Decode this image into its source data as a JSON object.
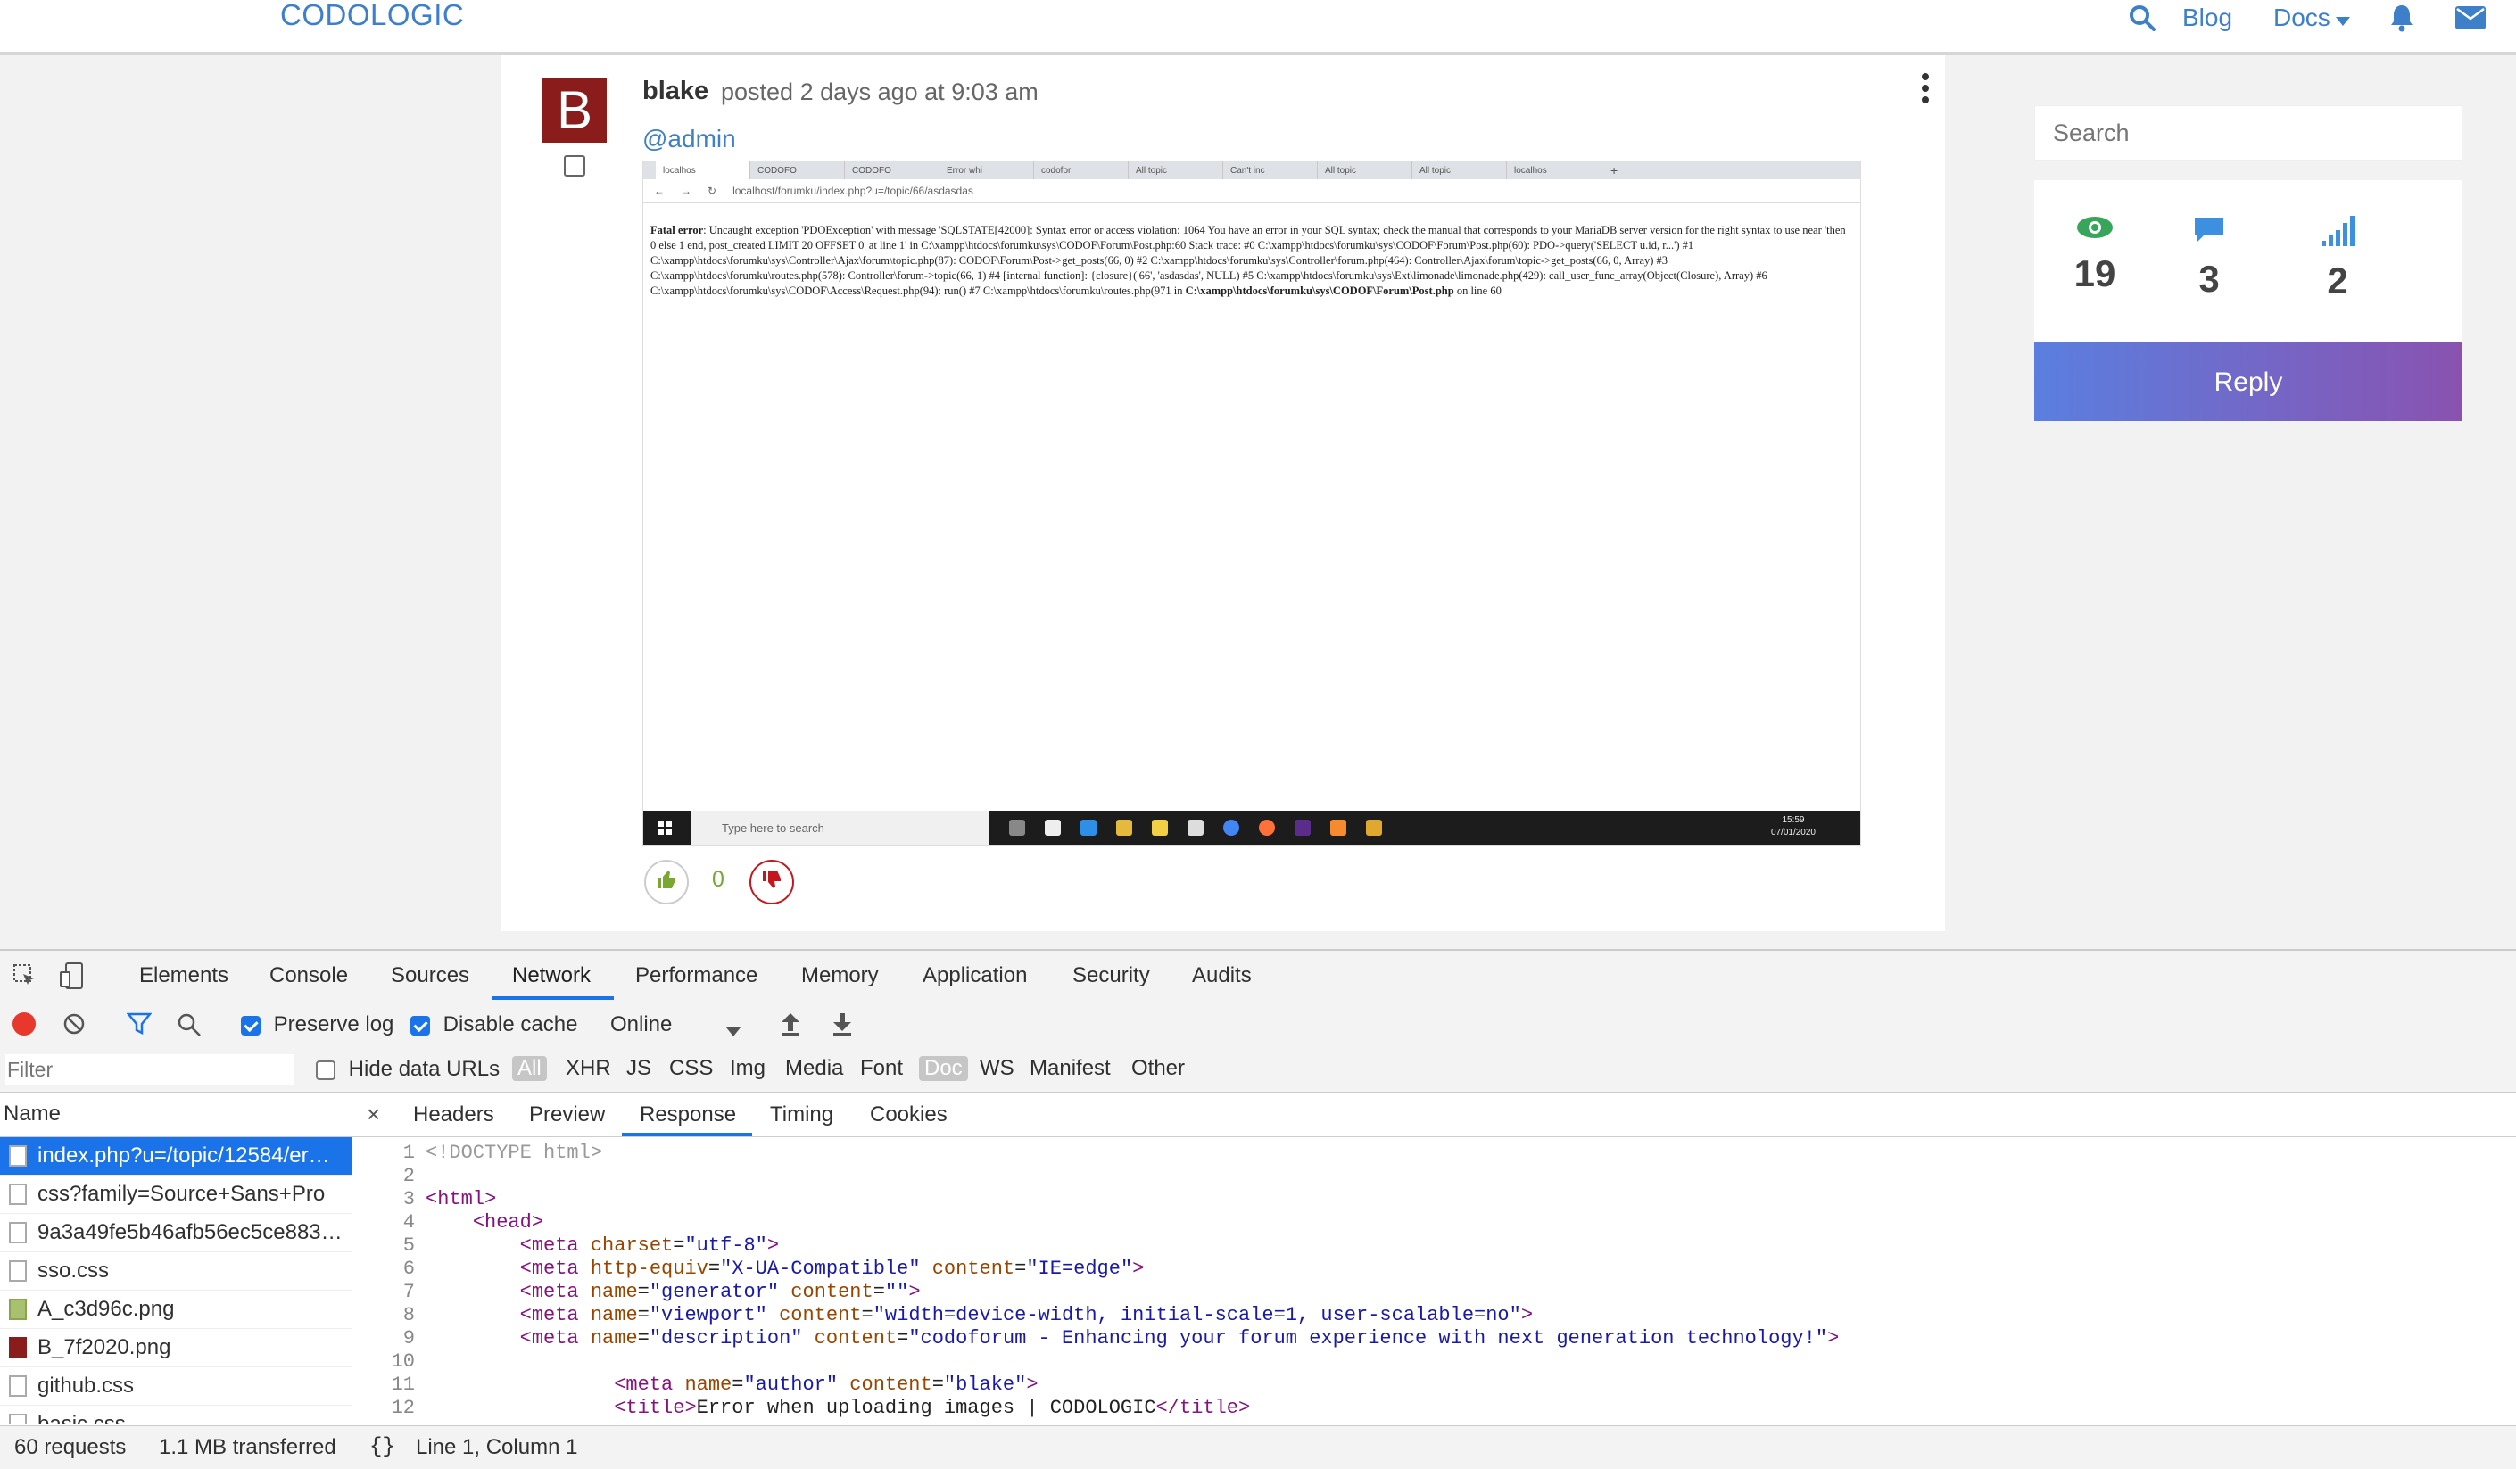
{
  "nav": {
    "brand": "CODOLOGIC",
    "blog": "Blog",
    "docs": "Docs",
    "accent": "#3d7fc9"
  },
  "post": {
    "avatar_letter": "B",
    "author": "blake",
    "posted": "posted 2 days ago at 9:03 am",
    "mention": "@admin",
    "vote_count": "0",
    "screenshot": {
      "tabs": [
        "localhos",
        "CODOFO",
        "CODOFO",
        "Error whi",
        "codofor",
        "All topic",
        "Can't inc",
        "All topic",
        "All topic",
        "localhos"
      ],
      "url": "localhost/forumku/index.php?u=/topic/66/asdasdas",
      "error_label": "Fatal error",
      "error_text": ": Uncaught exception 'PDOException' with message 'SQLSTATE[42000]: Syntax error or access violation: 1064 You have an error in your SQL syntax; check the manual that corresponds to your MariaDB server version for the right syntax to use near 'then 0 else 1 end, post_created LIMIT 20 OFFSET 0' at line 1' in C:\\xampp\\htdocs\\forumku\\sys\\CODOF\\Forum\\Post.php:60 Stack trace: #0 C:\\xampp\\htdocs\\forumku\\sys\\CODOF\\Forum\\Post.php(60): PDO->query('SELECT u.id, r...') #1 C:\\xampp\\htdocs\\forumku\\sys\\Controller\\Ajax\\forum\\topic.php(87): CODOF\\Forum\\Post->get_posts(66, 0) #2 C:\\xampp\\htdocs\\forumku\\sys\\Controller\\forum.php(464): Controller\\Ajax\\forum\\topic->get_posts(66, 0, Array) #3 C:\\xampp\\htdocs\\forumku\\routes.php(578): Controller\\forum->topic(66, 1) #4 [internal function]: {closure}('66', 'asdasdas', NULL) #5 C:\\xampp\\htdocs\\forumku\\sys\\Ext\\limonade\\limonade.php(429): call_user_func_array(Object(Closure), Array) #6 C:\\xampp\\htdocs\\forumku\\sys\\CODOF\\Access\\Request.php(94): run() #7 C:\\xampp\\htdocs\\forumku\\routes.php(971 in ",
      "error_file": "C:\\xampp\\htdocs\\forumku\\sys\\CODOF\\Forum\\Post.php",
      "error_tail": " on line 60",
      "taskbar_search": "Type here to search",
      "clock_time": "15:59",
      "clock_date": "07/01/2020"
    }
  },
  "sidebar": {
    "search_placeholder": "Search",
    "views": "19",
    "replies": "3",
    "rank": "2",
    "reply_label": "Reply"
  },
  "devtools": {
    "tabs": [
      "Elements",
      "Console",
      "Sources",
      "Network",
      "Performance",
      "Memory",
      "Application",
      "Security",
      "Audits"
    ],
    "preserve_log": "Preserve log",
    "disable_cache": "Disable cache",
    "throttle": "Online",
    "filter_placeholder": "Filter",
    "hide_data_urls": "Hide data URLs",
    "types": [
      "All",
      "XHR",
      "JS",
      "CSS",
      "Img",
      "Media",
      "Font",
      "Doc",
      "WS",
      "Manifest",
      "Other"
    ],
    "name_header": "Name",
    "requests": [
      "index.php?u=/topic/12584/er…",
      "css?family=Source+Sans+Pro",
      "9a3a49fe5b46afb56ec5ce883…",
      "sso.css",
      "A_c3d96c.png",
      "B_7f2020.png",
      "github.css",
      "basic.css"
    ],
    "detail_tabs": [
      "Headers",
      "Preview",
      "Response",
      "Timing",
      "Cookies"
    ],
    "code_lines": [
      "1",
      "2",
      "3",
      "4",
      "5",
      "6",
      "7",
      "8",
      "9",
      "10",
      "11",
      "12"
    ],
    "status_requests": "60 requests",
    "status_transferred": "1.1 MB transferred",
    "status_position": "Line 1, Column 1",
    "code": {
      "doctype": "<!DOCTYPE html>",
      "html_open": "<html>",
      "head_open": "<head>",
      "meta_charset": "\"utf-8\"",
      "meta_equiv": "\"X-UA-Compatible\"",
      "meta_equiv_content": "\"IE=edge\"",
      "meta_generator": "\"generator\"",
      "meta_generator_content": "\"\"",
      "meta_viewport": "\"viewport\"",
      "meta_viewport_content": "\"width=device-width, initial-scale=1, user-scalable=no\"",
      "meta_desc": "\"description\"",
      "meta_desc_content": "\"codoforum - Enhancing your forum experience with next generation technology!\"",
      "meta_author": "\"author\"",
      "meta_author_content": "\"blake\"",
      "title_text": "Error when uploading images | CODOLOGIC"
    }
  }
}
